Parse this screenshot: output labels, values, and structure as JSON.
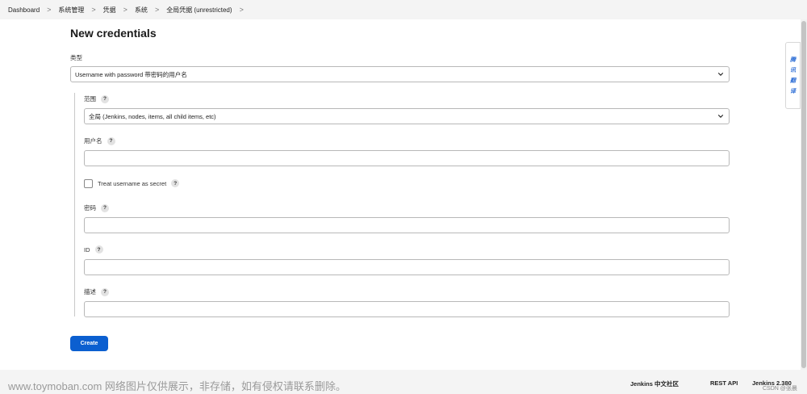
{
  "breadcrumb": {
    "items": [
      "Dashboard",
      "系统管理",
      "凭据",
      "系统",
      "全局凭据 (unrestricted)"
    ],
    "separator": ">"
  },
  "page": {
    "title": "New credentials"
  },
  "form": {
    "kind_label": "类型",
    "kind_value": "Username with password 带密码的用户名",
    "scope_label": "范围",
    "scope_value": "全局 (Jenkins, nodes, items, all child items, etc)",
    "username_label": "用户名",
    "username_value": "",
    "secret_label": "Treat username as secret",
    "secret_checked": false,
    "password_label": "密码",
    "password_value": "",
    "id_label": "ID",
    "id_value": "",
    "description_label": "描述",
    "description_value": "",
    "help_glyph": "?",
    "create_label": "Create"
  },
  "side_tab": {
    "chars": [
      "腾",
      "讯",
      "翻",
      "译"
    ]
  },
  "footer": {
    "community": "Jenkins 中文社区",
    "rest_api": "REST API",
    "version": "Jenkins 2.380",
    "watermark": "www.toymoban.com 网络图片仅供展示，非存储，如有侵权请联系删除。",
    "csdn": "CSDN @张晨"
  },
  "colors": {
    "accent": "#0b5fd0",
    "background": "#f4f4f4",
    "panel": "#ffffff"
  },
  "icons": {
    "breadcrumb_separator": "chevron-right-icon",
    "select_arrow": "chevron-down-icon",
    "help": "help-icon"
  }
}
